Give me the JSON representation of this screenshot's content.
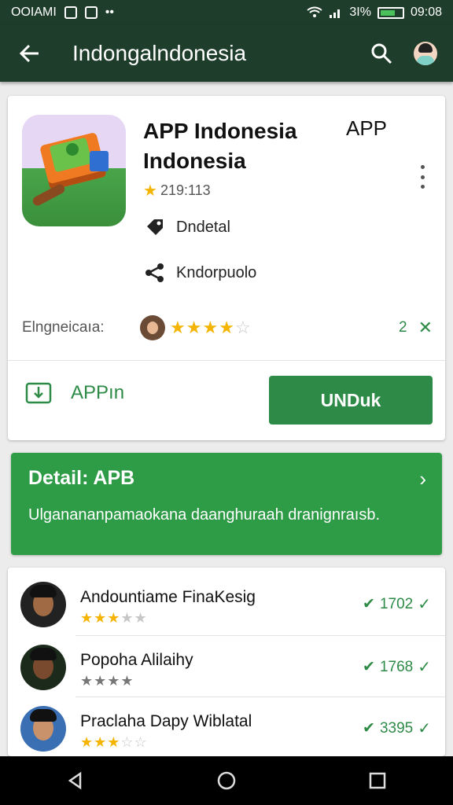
{
  "status_bar": {
    "left_text": "OOIAMI",
    "right_text": "3I%",
    "time": "09:08"
  },
  "app_bar": {
    "title": "Indongalndonesia",
    "icons": [
      "back-arrow-icon",
      "search-icon",
      "profile-avatar-icon"
    ]
  },
  "app_card": {
    "title": "APP Indonesia Indonesia",
    "title_right": "APP",
    "rating_text": "219:113",
    "meta": [
      {
        "icon": "tag-icon",
        "label": "Dndetal"
      },
      {
        "icon": "share-icon",
        "label": "Kndorpuolo"
      }
    ],
    "rating_label": "Elngneicaıa:",
    "rating_stars": 4,
    "rating_count": "2",
    "secondary_action_label": "APPın",
    "install_label": "UNDuk"
  },
  "detail": {
    "title": "Detail: APB",
    "text": "Ulganananpamaokana daanghuraah dranignraısb."
  },
  "reviews": [
    {
      "name": "Andountiame FinaKesig",
      "stars": 2.5,
      "value": "1702"
    },
    {
      "name": "Popoha Alilaihy",
      "stars": 4,
      "value": "1768"
    },
    {
      "name": "Praclaha Dapy Wiblatal",
      "stars": 3,
      "value": "3395"
    }
  ],
  "colors": {
    "app_bar": "#1f3d2b",
    "accent": "#2e8b47",
    "star": "#f4b400"
  }
}
